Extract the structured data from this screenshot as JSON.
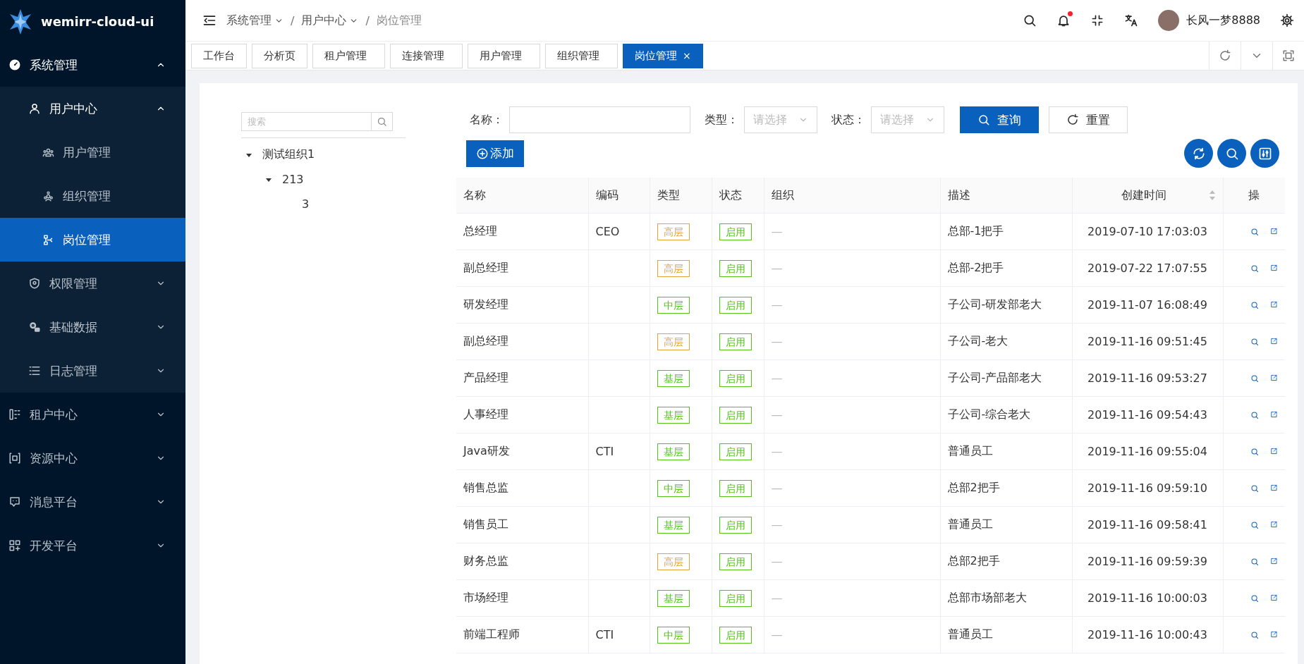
{
  "brand": {
    "name": "wemirr-cloud-ui"
  },
  "sidebar": {
    "items": [
      {
        "label": "系统管理",
        "expanded": true,
        "selected": false,
        "children": [
          {
            "label": "用户中心",
            "expanded": true,
            "selected": false,
            "children": [
              {
                "label": "用户管理",
                "selected": false
              },
              {
                "label": "组织管理",
                "selected": false
              },
              {
                "label": "岗位管理",
                "selected": true
              }
            ]
          },
          {
            "label": "权限管理",
            "expanded": false,
            "selected": false
          },
          {
            "label": "基础数据",
            "expanded": false,
            "selected": false
          },
          {
            "label": "日志管理",
            "expanded": false,
            "selected": false
          }
        ]
      },
      {
        "label": "租户中心",
        "expanded": false,
        "selected": false
      },
      {
        "label": "资源中心",
        "expanded": false,
        "selected": false
      },
      {
        "label": "消息平台",
        "expanded": false,
        "selected": false
      },
      {
        "label": "开发平台",
        "expanded": false,
        "selected": false
      }
    ]
  },
  "header": {
    "breadcrumb": [
      {
        "label": "系统管理",
        "dropdown": true
      },
      {
        "separator": "/",
        "label": "用户中心",
        "dropdown": true
      },
      {
        "separator": "/",
        "label": "岗位管理",
        "dropdown": false
      }
    ],
    "notifications": {
      "unread": true
    },
    "user": {
      "name": "长风一梦8888"
    }
  },
  "tabs": [
    {
      "label": "工作台",
      "selected": false
    },
    {
      "label": "分析页",
      "selected": false
    },
    {
      "label": "租户管理",
      "selected": false
    },
    {
      "label": "连接管理",
      "selected": false
    },
    {
      "label": "用户管理",
      "selected": false
    },
    {
      "label": "组织管理",
      "selected": false
    },
    {
      "label": "岗位管理",
      "selected": true,
      "close": "×"
    }
  ],
  "tree": {
    "search": {
      "placeholder": "搜索"
    },
    "nodes": [
      {
        "label": "测试组织1",
        "expanded": true,
        "children": [
          {
            "label": "213",
            "expanded": true,
            "children": [
              {
                "label": "3"
              }
            ]
          }
        ]
      }
    ]
  },
  "filters": [
    {
      "kind": "text",
      "label": "名称："
    },
    {
      "kind": "select",
      "label": "类型：",
      "placeholder": "请选择"
    },
    {
      "kind": "select",
      "label": "状态：",
      "placeholder": "请选择"
    }
  ],
  "filter_buttons": [
    {
      "label": "查询",
      "kind": "primary"
    },
    {
      "label": "重置",
      "kind": "default"
    }
  ],
  "add_button": {
    "label": "添加"
  },
  "table": {
    "columns": [
      {
        "label": "名称",
        "sortable": false
      },
      {
        "label": "编码",
        "sortable": false
      },
      {
        "label": "类型",
        "sortable": false
      },
      {
        "label": "状态",
        "sortable": false
      },
      {
        "label": "组织",
        "sortable": false
      },
      {
        "label": "描述",
        "sortable": false
      },
      {
        "label": "创建时间",
        "sortable": true
      },
      {
        "label": "操",
        "sortable": false
      }
    ],
    "rows": [
      {
        "name": "总经理",
        "code": "CEO",
        "type": {
          "text": "高层",
          "color": "#e6a23c"
        },
        "status": {
          "text": "启用",
          "color": "#52c41a"
        },
        "org": "—",
        "desc": "总部-1把手",
        "time": "2019-07-10 17:03:03"
      },
      {
        "name": "副总经理",
        "type": {
          "text": "高层",
          "color": "#e6a23c"
        },
        "status": {
          "text": "启用",
          "color": "#52c41a"
        },
        "org": "—",
        "desc": "总部-2把手",
        "time": "2019-07-22 17:07:55"
      },
      {
        "name": "研发经理",
        "type": {
          "text": "中层",
          "color": "#52c41a"
        },
        "status": {
          "text": "启用",
          "color": "#52c41a"
        },
        "org": "—",
        "desc": "子公司-研发部老大",
        "time": "2019-11-07 16:08:49"
      },
      {
        "name": "副总经理",
        "type": {
          "text": "高层",
          "color": "#e6a23c"
        },
        "status": {
          "text": "启用",
          "color": "#52c41a"
        },
        "org": "—",
        "desc": "子公司-老大",
        "time": "2019-11-16 09:51:45"
      },
      {
        "name": "产品经理",
        "type": {
          "text": "基层",
          "color": "#52c41a"
        },
        "status": {
          "text": "启用",
          "color": "#52c41a"
        },
        "org": "—",
        "desc": "子公司-产品部老大",
        "time": "2019-11-16 09:53:27"
      },
      {
        "name": "人事经理",
        "type": {
          "text": "基层",
          "color": "#52c41a"
        },
        "status": {
          "text": "启用",
          "color": "#52c41a"
        },
        "org": "—",
        "desc": "子公司-综合老大",
        "time": "2019-11-16 09:54:43"
      },
      {
        "name": "Java研发",
        "code": "CTI",
        "type": {
          "text": "基层",
          "color": "#52c41a"
        },
        "status": {
          "text": "启用",
          "color": "#52c41a"
        },
        "org": "—",
        "desc": "普通员工",
        "time": "2019-11-16 09:55:04"
      },
      {
        "name": "销售总监",
        "type": {
          "text": "中层",
          "color": "#52c41a"
        },
        "status": {
          "text": "启用",
          "color": "#52c41a"
        },
        "org": "—",
        "desc": "总部2把手",
        "time": "2019-11-16 09:59:10"
      },
      {
        "name": "销售员工",
        "type": {
          "text": "基层",
          "color": "#52c41a"
        },
        "status": {
          "text": "启用",
          "color": "#52c41a"
        },
        "org": "—",
        "desc": "普通员工",
        "time": "2019-11-16 09:58:41"
      },
      {
        "name": "财务总监",
        "type": {
          "text": "高层",
          "color": "#e6a23c"
        },
        "status": {
          "text": "启用",
          "color": "#52c41a"
        },
        "org": "—",
        "desc": "总部2把手",
        "time": "2019-11-16 09:59:39"
      },
      {
        "name": "市场经理",
        "type": {
          "text": "基层",
          "color": "#52c41a"
        },
        "status": {
          "text": "启用",
          "color": "#52c41a"
        },
        "org": "—",
        "desc": "总部市场部老大",
        "time": "2019-11-16 10:00:03"
      },
      {
        "name": "前端工程师",
        "code": "CTI",
        "type": {
          "text": "中层",
          "color": "#52c41a"
        },
        "status": {
          "text": "启用",
          "color": "#52c41a"
        },
        "org": "—",
        "desc": "普通员工",
        "time": "2019-11-16 10:00:43"
      }
    ]
  }
}
